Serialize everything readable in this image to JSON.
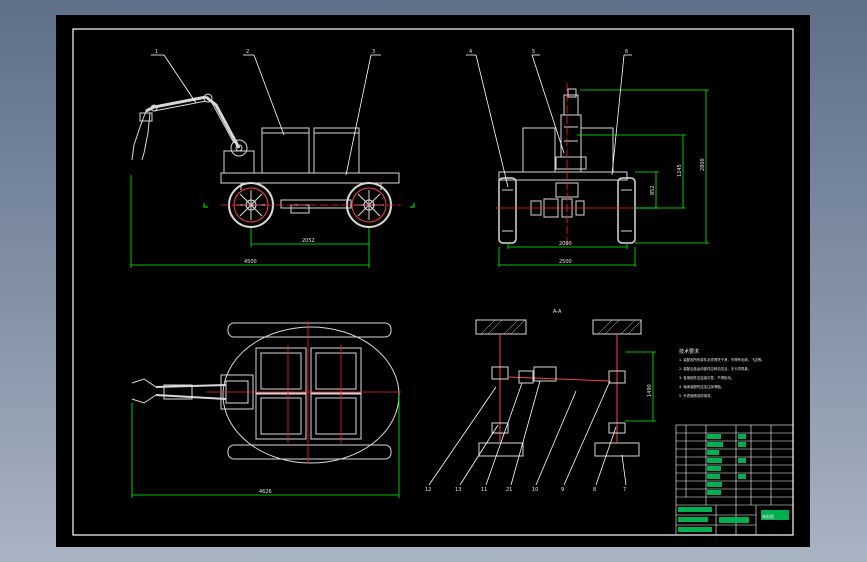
{
  "colors": {
    "background": "#000000",
    "frame": "#ffffff",
    "dimension": "#00ff00",
    "centerline": "#ff2020",
    "annotation": "#ffffff",
    "part": "#d8d8d8"
  },
  "drawing": {
    "top_section_label": "A-A",
    "views": [
      "side-view",
      "front-view",
      "plan-view",
      "transmission-schematic"
    ]
  },
  "callouts": {
    "side_view": [
      "1",
      "2",
      "3"
    ],
    "front_view": [
      "4",
      "5",
      "6"
    ],
    "schematic_bottom": [
      "12",
      "13",
      "11",
      "21",
      "10",
      "9",
      "8",
      "7"
    ]
  },
  "dimensions": {
    "side_wheelbase": "2052",
    "side_overall_length": "4500",
    "front_track": "2000",
    "front_overall_width": "2500",
    "front_height_small": "852",
    "front_height_mid": "1245",
    "front_height_total": "2800",
    "plan_overall_length": "4626",
    "schematic_height": "1490"
  },
  "notes": {
    "title": "技术要求",
    "lines": [
      "1. 装配前所有零件必须清洗干净，不得有毛刺、飞边等。",
      "2. 装配后各运动部件应转动灵活，无卡滞现象。",
      "3. 各紧固件应连接可靠，不得松动。",
      "4. 轴承装配时应加注润滑脂。",
      "5. 外表面喷涂防锈漆。"
    ]
  },
  "title_block": {
    "bottom_row_label": "装配图"
  }
}
